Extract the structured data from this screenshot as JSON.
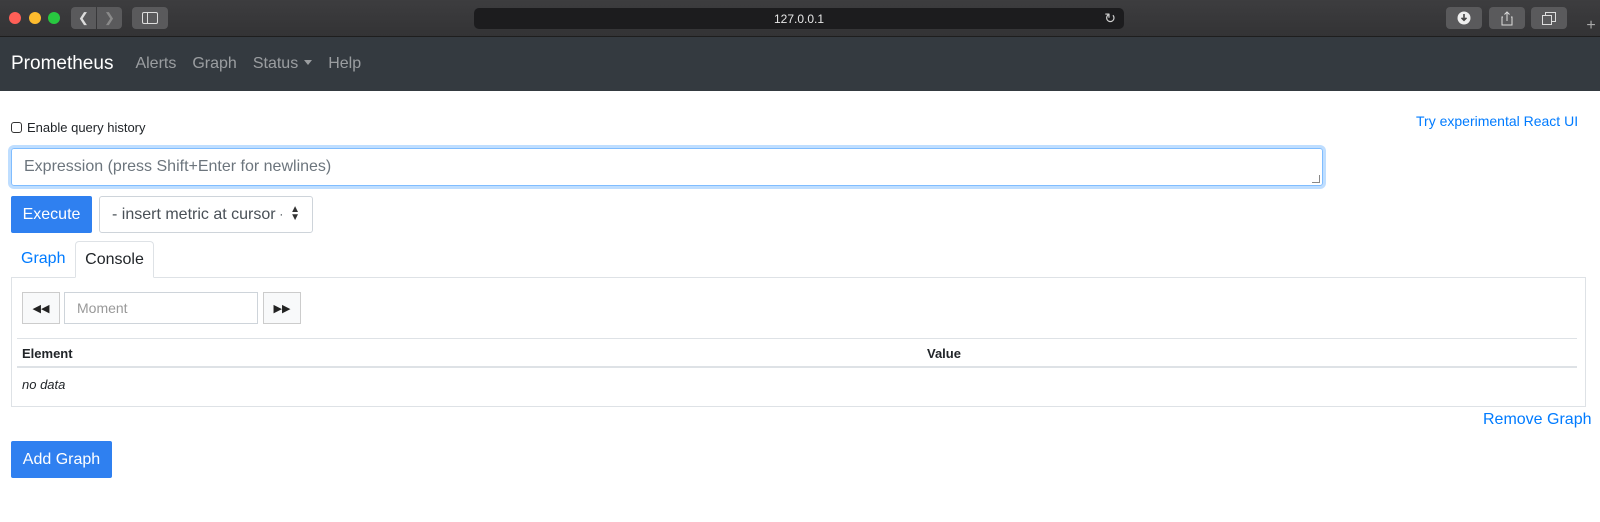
{
  "browser": {
    "url": "127.0.0.1",
    "icons": {
      "back": "chevron-left-icon",
      "forward": "chevron-right-icon",
      "sidebar": "sidebar-icon",
      "reload": "reload-icon",
      "download": "download-icon",
      "share": "share-icon",
      "tabs": "tabs-icon",
      "new_tab": "plus-icon"
    }
  },
  "navbar": {
    "brand": "Prometheus",
    "links": [
      "Alerts",
      "Graph",
      "Status",
      "Help"
    ]
  },
  "query": {
    "history_label": "Enable query history",
    "history_checked": false,
    "react_link": "Try experimental React UI",
    "expression_placeholder": "Expression (press Shift+Enter for newlines)",
    "execute_label": "Execute",
    "metric_select": "- insert metric at cursor -"
  },
  "tabs": [
    "Graph",
    "Console"
  ],
  "active_tab": "Console",
  "console": {
    "moment_placeholder": "Moment",
    "columns": [
      "Element",
      "Value"
    ],
    "empty_text": "no data"
  },
  "actions": {
    "remove_graph": "Remove Graph",
    "add_graph": "Add Graph"
  },
  "colors": {
    "primary": "#2f80f0",
    "link": "#007bff",
    "navbar": "#343a40"
  }
}
